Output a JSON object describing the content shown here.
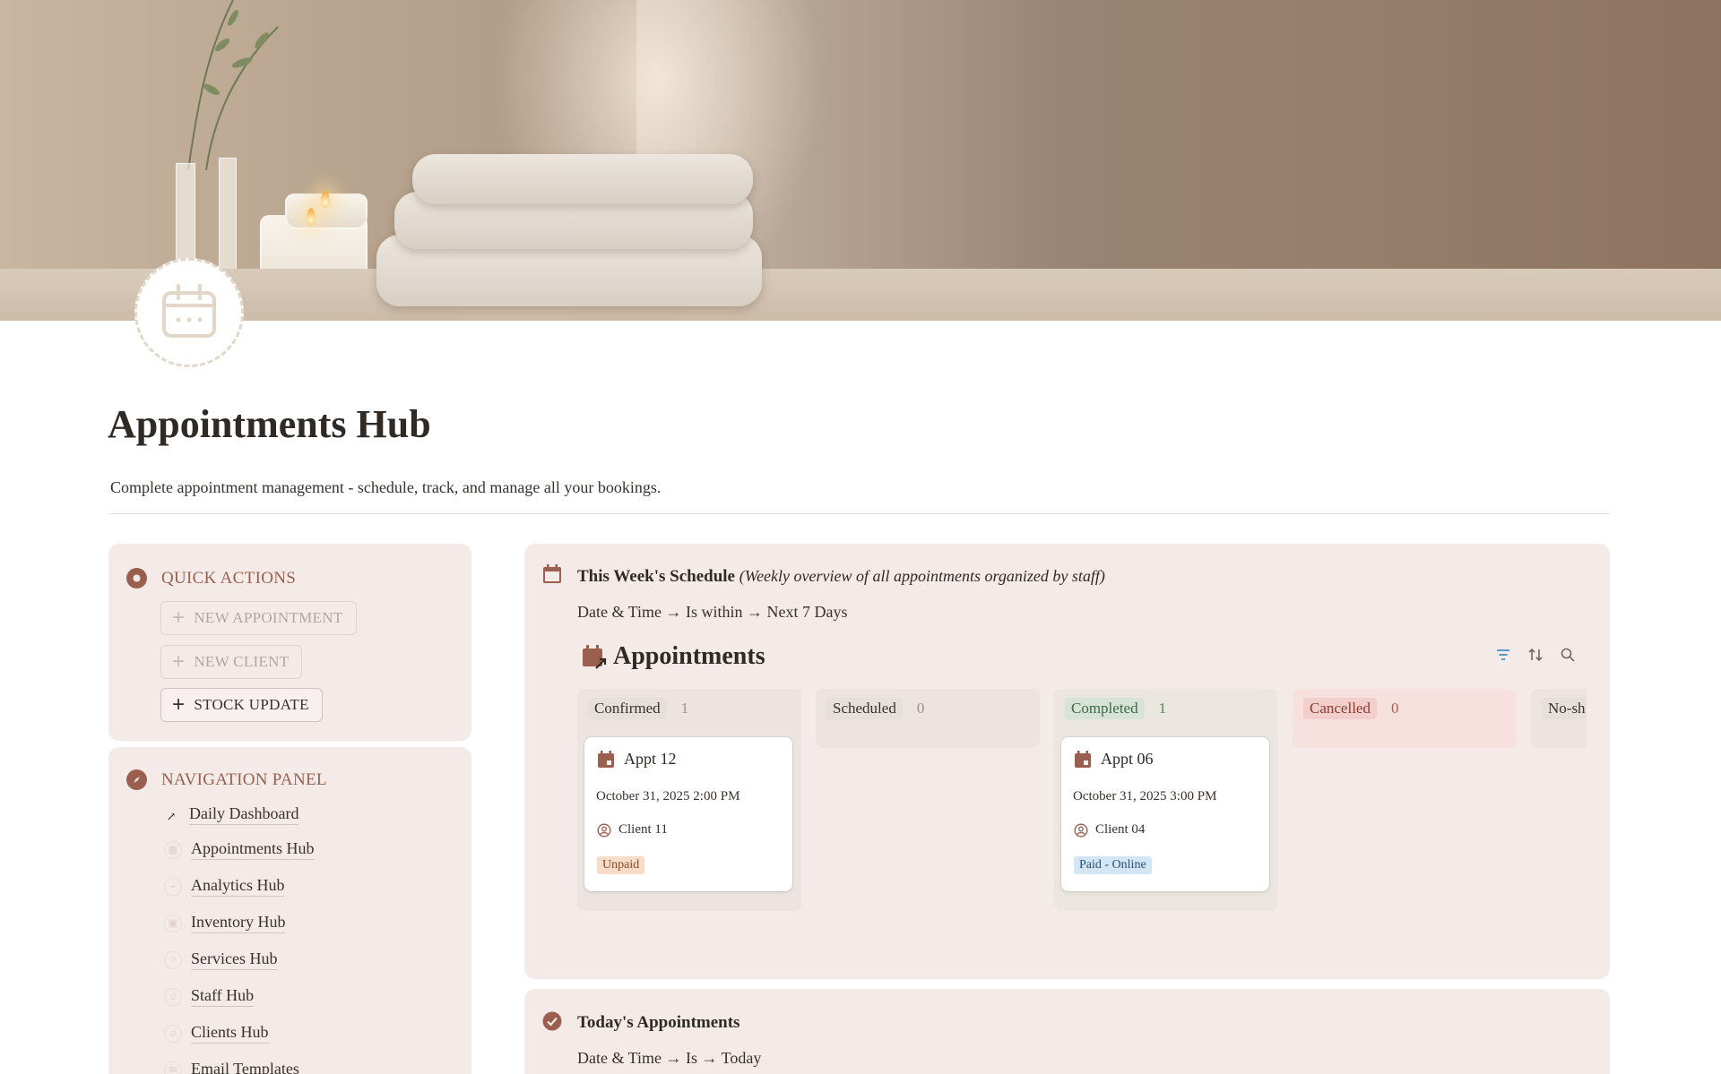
{
  "page": {
    "title": "Appointments Hub",
    "description": "Complete appointment management - schedule, track, and manage all your bookings."
  },
  "quick_actions": {
    "heading": "QUICK ACTIONS",
    "buttons": [
      {
        "label": "NEW APPOINTMENT",
        "state": "disabled"
      },
      {
        "label": "NEW CLIENT",
        "state": "disabled"
      },
      {
        "label": "STOCK UPDATE",
        "state": "enabled"
      }
    ]
  },
  "navigation": {
    "heading": "NAVIGATION PANEL",
    "items": [
      {
        "label": "Daily Dashboard",
        "icon": "link-arrow-icon"
      },
      {
        "label": "Appointments Hub",
        "icon": "calendar-icon"
      },
      {
        "label": "Analytics Hub",
        "icon": "chart-icon"
      },
      {
        "label": "Inventory Hub",
        "icon": "box-icon"
      },
      {
        "label": "Services Hub",
        "icon": "sparkle-icon"
      },
      {
        "label": "Staff Hub",
        "icon": "people-icon"
      },
      {
        "label": "Clients Hub",
        "icon": "person-icon"
      },
      {
        "label": "Email Templates",
        "icon": "mail-icon"
      }
    ]
  },
  "weekly_schedule": {
    "title": "This Week's Schedule",
    "subtitle": "(Weekly overview of all appointments organized by staff)",
    "filter": "Date & Time → Is within → Next 7 Days",
    "database_title": "Appointments",
    "columns": [
      {
        "status": "Confirmed",
        "count": "1",
        "tag_bg": "#e6dfdb",
        "tag_fg": "#37322e",
        "count_fg": "#9b918c",
        "col_bg": "#ede4e1",
        "cards": [
          {
            "name": "Appt 12",
            "date": "October 31, 2025 2:00 PM",
            "client": "Client 11",
            "payment": "Unpaid",
            "pay_bg": "#f7dcc9",
            "pay_fg": "#8a4a25"
          }
        ]
      },
      {
        "status": "Scheduled",
        "count": "0",
        "tag_bg": "#e6dfdb",
        "tag_fg": "#37322e",
        "count_fg": "#9b918c",
        "col_bg": "#ede4e1",
        "cards": []
      },
      {
        "status": "Completed",
        "count": "1",
        "tag_bg": "#d6e3d6",
        "tag_fg": "#3d6a48",
        "count_fg": "#4c8a5a",
        "col_bg": "#ebe6df",
        "cards": [
          {
            "name": "Appt 06",
            "date": "October 31, 2025 3:00 PM",
            "client": "Client 04",
            "payment": "Paid - Online",
            "pay_bg": "#d4e5f4",
            "pay_fg": "#28507a"
          }
        ]
      },
      {
        "status": "Cancelled",
        "count": "0",
        "tag_bg": "#f3cfcb",
        "tag_fg": "#8d3b34",
        "count_fg": "#c4554b",
        "col_bg": "#f7e1de",
        "cards": []
      },
      {
        "status": "No-sh",
        "count": "",
        "tag_bg": "#e6dfdb",
        "tag_fg": "#37322e",
        "count_fg": "#9b918c",
        "col_bg": "#ede4e1",
        "cards": []
      }
    ]
  },
  "today": {
    "title": "Today's Appointments",
    "filter": "Date & Time → Is → Today"
  },
  "colors": {
    "accent": "#9a5f4e",
    "panel_bg": "#f4ebe8",
    "filter_icon": "#4a90c8"
  }
}
